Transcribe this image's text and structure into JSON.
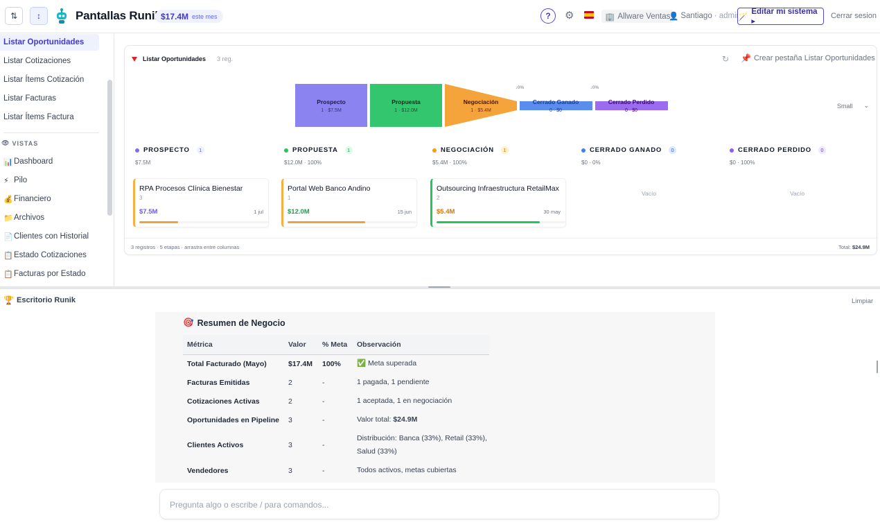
{
  "header": {
    "title": "Pantallas Runik",
    "kpi_value": "$17.4M",
    "kpi_label": "este mes",
    "help": "?",
    "company": "Allware Ventas",
    "user": "Santiago",
    "role": "· admin",
    "edit_label": "Editar mi sistema ▸",
    "logout_label": "Cerrar sesion"
  },
  "sidebar": {
    "items": [
      {
        "label": "Listar Oportunidades",
        "icon": ""
      },
      {
        "label": "Listar Cotizaciones",
        "icon": ""
      },
      {
        "label": "Listar Ítems Cotización",
        "icon": ""
      },
      {
        "label": "Listar Facturas",
        "icon": ""
      },
      {
        "label": "Listar Ítems Factura",
        "icon": ""
      }
    ],
    "section": "VISTAS",
    "views": [
      {
        "label": "Dashboard",
        "icon": "📊"
      },
      {
        "label": "Pilo",
        "icon": "⚡"
      },
      {
        "label": "Financiero",
        "icon": "💰"
      },
      {
        "label": "Archivos",
        "icon": "📁"
      },
      {
        "label": "Clientes con Historial",
        "icon": "📄"
      },
      {
        "label": "Estado Cotizaciones",
        "icon": "📋"
      },
      {
        "label": "Facturas por Estado",
        "icon": "📋"
      }
    ]
  },
  "card": {
    "title": "Listar Oportunidades",
    "count": "3 reg.",
    "create_tab": "Crear pestaña Listar Oportunidades",
    "size": "Small",
    "footer_left": "3 registros · 5 etapas · arrastra entre columnas",
    "footer_total_label": "Total:",
    "footer_total": "$24.9M"
  },
  "funnel": {
    "stages": [
      {
        "name": "Prospecto",
        "sub": "1 · $7.5M",
        "color": "#8b84f0",
        "pct": ""
      },
      {
        "name": "Propuesta",
        "sub": "1 · $12.0M",
        "color": "#34c66e",
        "pct": ""
      },
      {
        "name": "Negociación",
        "sub": "1 · $5.4M",
        "color": "#f5a33b",
        "pct": ""
      },
      {
        "name": "Cerrado Ganado",
        "sub": "0 · $0",
        "color": "#5b8def",
        "pct": "↓0%"
      },
      {
        "name": "Cerrado Perdido",
        "sub": "0 · $0",
        "color": "#9b6cf0",
        "pct": "↓0%"
      }
    ]
  },
  "columns": [
    {
      "name": "PROSPECTO",
      "count": "1",
      "sub": "$7.5M",
      "color": "#7c6cf0",
      "badge_bg": "#eef2ff",
      "badge_fg": "#6366f1"
    },
    {
      "name": "PROPUESTA",
      "count": "1",
      "sub": "$12.0M · 100%",
      "color": "#22c55e",
      "badge_bg": "#dcfce7",
      "badge_fg": "#16a34a"
    },
    {
      "name": "NEGOCIACIÓN",
      "count": "1",
      "sub": "$5.4M · 100%",
      "color": "#f59e0b",
      "badge_bg": "#fef3c7",
      "badge_fg": "#d97706"
    },
    {
      "name": "CERRADO GANADO",
      "count": "0",
      "sub": "$0 · 0%",
      "color": "#3b82f6",
      "badge_bg": "#dbeafe",
      "badge_fg": "#2563eb"
    },
    {
      "name": "CERRADO PERDIDO",
      "count": "0",
      "sub": "$0 · 100%",
      "color": "#8b5cf6",
      "badge_bg": "#ede9fe",
      "badge_fg": "#7c3aed"
    }
  ],
  "deals": [
    {
      "name": "RPA Procesos Clínica Bienestar",
      "number": "3",
      "amount": "$7.5M",
      "date": "1 jul",
      "progress": 0.3,
      "border": "#f5b041",
      "amount_color": "#6d5ce8",
      "bar_color": "#e8a33a"
    },
    {
      "name": "Portal Web Banco Andino",
      "number": "1",
      "amount": "$12.0M",
      "date": "15 jun",
      "progress": 0.6,
      "border": "#f5b041",
      "amount_color": "#16a34a",
      "bar_color": "#e8a33a"
    },
    {
      "name": "Outsourcing Infraestructura RetailMax",
      "number": "2",
      "amount": "$5.4M",
      "date": "30 may",
      "progress": 0.8,
      "border": "#22c55e",
      "amount_color": "#d97706",
      "bar_color": "#22c55e"
    }
  ],
  "empty_label": "Vacío",
  "desk": {
    "title": "Escritorio Runik",
    "clear": "Limpiar",
    "summary_title": "Resumen de Negocio",
    "columns": [
      "Métrica",
      "Valor",
      "% Meta",
      "Observación"
    ],
    "rows": [
      {
        "metric": "Total Facturado (Mayo)",
        "value": "$17.4M",
        "goal": "100%",
        "obs": "✅ Meta superada"
      },
      {
        "metric": "Facturas Emitidas",
        "value": "2",
        "goal": "-",
        "obs": "1 pagada, 1 pendiente"
      },
      {
        "metric": "Cotizaciones Activas",
        "value": "2",
        "goal": "-",
        "obs": "1 aceptada, 1 en negociación"
      },
      {
        "metric": "Oportunidades en Pipeline",
        "value": "3",
        "goal": "-",
        "obs_prefix": "Valor total: ",
        "obs_bold": "$24.9M"
      },
      {
        "metric": "Clientes Activos",
        "value": "3",
        "goal": "-",
        "obs": "Distribución: Banca (33%), Retail (33%), Salud (33%)"
      },
      {
        "metric": "Vendedores",
        "value": "3",
        "goal": "-",
        "obs": "Todos activos, metas cubiertas"
      }
    ],
    "input_placeholder": "Pregunta algo o escribe / para comandos..."
  }
}
